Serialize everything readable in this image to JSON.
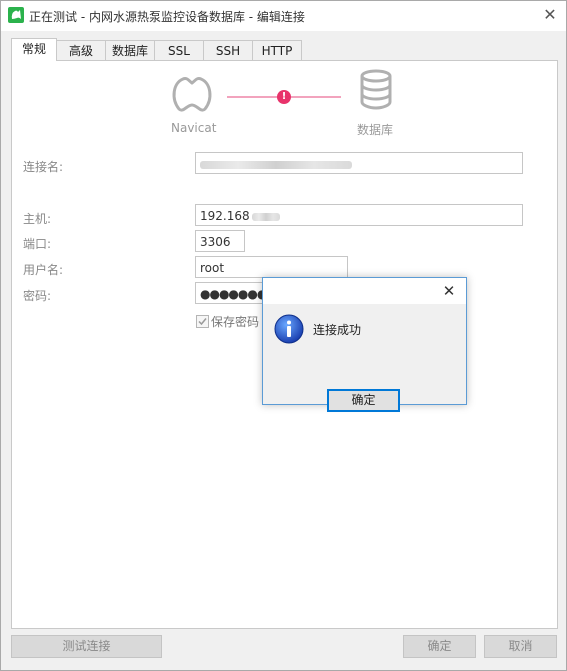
{
  "window": {
    "title": "正在测试 - 内网水源热泵监控设备数据库 - 编辑连接"
  },
  "tabs": [
    {
      "label": "常规",
      "active": true
    },
    {
      "label": "高级"
    },
    {
      "label": "数据库"
    },
    {
      "label": "SSL"
    },
    {
      "label": "SSH"
    },
    {
      "label": "HTTP"
    }
  ],
  "diagram": {
    "left_label": "Navicat",
    "right_label": "数据库",
    "status_color": "#e8336b",
    "line_color": "#f2a3bd"
  },
  "form": {
    "connection_name_label": "连接名:",
    "host_label": "主机:",
    "host_value": "192.168",
    "port_label": "端口:",
    "port_value": "3306",
    "user_label": "用户名:",
    "user_value": "root",
    "password_label": "密码:",
    "password_value": "●●●●●●●●●",
    "save_password_label": "保存密码",
    "save_password_checked": true
  },
  "footer": {
    "test_button": "测试连接",
    "ok_button": "确定",
    "cancel_button": "取消"
  },
  "dialog": {
    "message": "连接成功",
    "ok_button": "确定",
    "accent": "#0078d7"
  }
}
